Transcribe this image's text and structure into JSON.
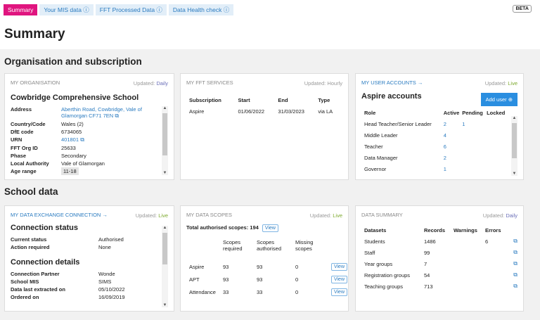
{
  "tabs": [
    "Summary",
    "Your MIS data ⓘ",
    "FFT Processed Data ⓘ",
    "Data Health check ⓘ"
  ],
  "beta": "BETA",
  "title": "Summary",
  "sections": {
    "org": "Organisation and subscription",
    "school": "School data"
  },
  "updated_label": "Updated:",
  "org": {
    "title": "MY ORGANISATION",
    "freq": "Daily",
    "name": "Cowbridge Comprehensive School",
    "rows": [
      [
        "Address",
        "Aberthin Road, Cowbridge, Vale of Glamorgan CF71 7EN"
      ],
      [
        "Country/Code",
        "Wales (2)"
      ],
      [
        "DfE code",
        "6734065"
      ],
      [
        "URN",
        "401801"
      ],
      [
        "FFT Org ID",
        "25633"
      ],
      [
        "Phase",
        "Secondary"
      ],
      [
        "Local Authority",
        "Vale of Glamorgan"
      ],
      [
        "Age range",
        "11-18"
      ]
    ]
  },
  "services": {
    "title": "MY FFT SERVICES",
    "freq": "Hourly",
    "headers": [
      "Subscription",
      "Start",
      "End",
      "Type"
    ],
    "rows": [
      [
        "Aspire",
        "01/06/2022",
        "31/03/2023",
        "via LA"
      ]
    ]
  },
  "users": {
    "title": "MY USER ACCOUNTS →",
    "freq": "Live",
    "heading": "Aspire accounts",
    "add": "Add user ⊕",
    "headers": [
      "Role",
      "Active",
      "Pending",
      "Locked"
    ],
    "rows": [
      [
        "Head Teacher/Senior Leader",
        "2",
        "1",
        ""
      ],
      [
        "Middle Leader",
        "4",
        "",
        ""
      ],
      [
        "Teacher",
        "6",
        "",
        ""
      ],
      [
        "Data Manager",
        "2",
        "",
        ""
      ],
      [
        "Governor",
        "1",
        "",
        ""
      ]
    ]
  },
  "dx": {
    "title": "MY DATA EXCHANGE CONNECTION →",
    "freq": "Live",
    "status_heading": "Connection status",
    "status": [
      [
        "Current status",
        "Authorised"
      ],
      [
        "Action required",
        "None"
      ]
    ],
    "details_heading": "Connection details",
    "details": [
      [
        "Connection Partner",
        "Wonde"
      ],
      [
        "School MIS",
        "SIMS"
      ],
      [
        "Data last extracted on",
        "05/10/2022"
      ],
      [
        "Ordered on",
        "16/09/2019"
      ]
    ]
  },
  "scopes": {
    "title": "MY DATA SCOPES",
    "freq": "Live",
    "total": "Total authorised scopes: 194",
    "view": "View",
    "headers": [
      "",
      "Scopes required",
      "Scopes authorised",
      "Missing scopes"
    ],
    "rows": [
      [
        "Aspire",
        "93",
        "93",
        "0"
      ],
      [
        "APT",
        "93",
        "93",
        "0"
      ],
      [
        "Attendance",
        "33",
        "33",
        "0"
      ]
    ]
  },
  "summary": {
    "title": "DATA SUMMARY",
    "freq": "Daily",
    "headers": [
      "Datasets",
      "Records",
      "Warnings",
      "Errors"
    ],
    "rows": [
      [
        "Students",
        "1486",
        "",
        "6"
      ],
      [
        "Staff",
        "99",
        "",
        ""
      ],
      [
        "Year groups",
        "7",
        "",
        ""
      ],
      [
        "Registration groups",
        "54",
        "",
        ""
      ],
      [
        "Teaching groups",
        "713",
        "",
        ""
      ]
    ]
  }
}
